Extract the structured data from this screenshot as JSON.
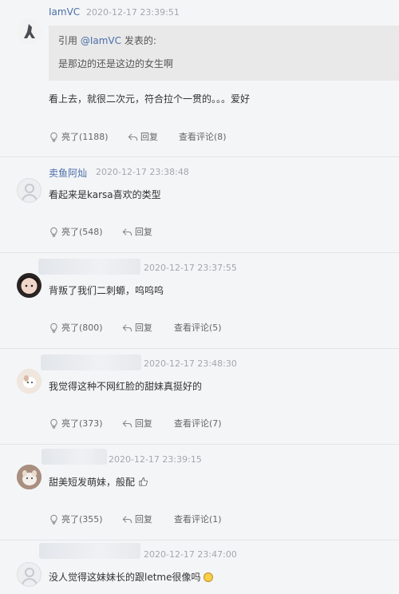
{
  "comments": [
    {
      "username": "IamVC",
      "time": "2020-12-17 23:39:51",
      "quote": {
        "prefix": "引用",
        "user": "@IamVC",
        "suffix": "发表的:",
        "text": "是那边的还是这边的女生啊"
      },
      "text": "看上去，就很二次元，符合拉个一贯的。。。爱好",
      "like": "亮了(1188)",
      "reply": "回复",
      "view": "查看评论(8)"
    },
    {
      "username": "卖鱼阿灿",
      "time": "2020-12-17 23:38:48",
      "text": "看起来是karsa喜欢的类型",
      "like": "亮了(548)",
      "reply": "回复"
    },
    {
      "time": "2020-12-17 23:37:55",
      "text": "背叛了我们二刺螈，呜呜呜",
      "like": "亮了(800)",
      "reply": "回复",
      "view": "查看评论(5)"
    },
    {
      "time": "2020-12-17 23:48:30",
      "text": "我觉得这种不网红脸的甜妹真挺好的",
      "like": "亮了(373)",
      "reply": "回复",
      "view": "查看评论(7)"
    },
    {
      "time": "2020-12-17 23:39:15",
      "text": "甜美短发萌妹，般配",
      "like": "亮了(355)",
      "reply": "回复",
      "view": "查看评论(1)"
    },
    {
      "time": "2020-12-17 23:47:00",
      "text": "没人觉得这妹妹长的跟letme很像吗"
    }
  ],
  "icons": {
    "like": "lightbulb-icon",
    "reply": "reply-arrow-icon",
    "thumbs_up_emoji": "thumbs-up-emoji-icon",
    "sad_emoji": "sad-face-emoji-icon"
  },
  "colors": {
    "username": "#4a6ea8",
    "timestamp": "#a3a7ad",
    "background": "#f4f5f7",
    "quote_bg": "#e9e9e9"
  }
}
